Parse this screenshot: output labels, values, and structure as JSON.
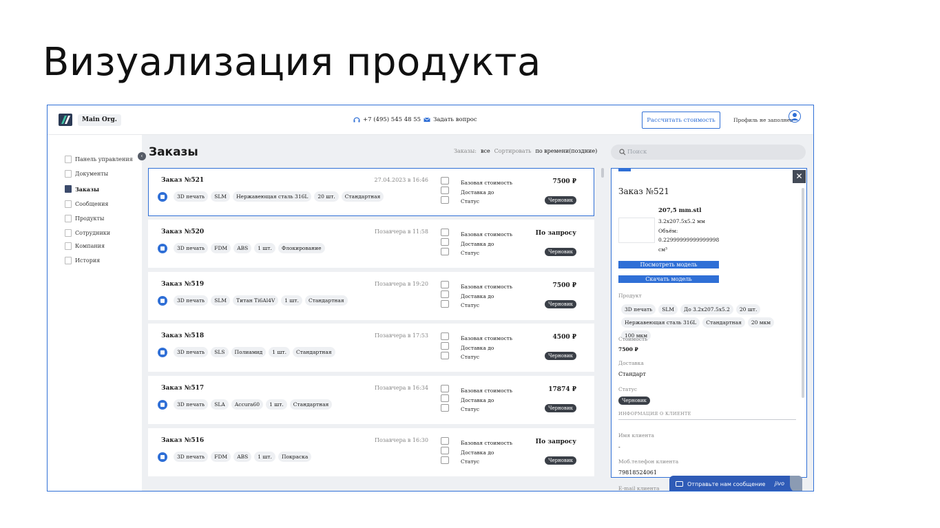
{
  "slide": {
    "title": "Визуализация продукта"
  },
  "header": {
    "org": "Main Org.",
    "phone": "+7 (495) 545 48 55",
    "ask": "Задать вопрос",
    "calc_button": "Рассчитать стоимость",
    "profile": "Профиль не заполнен"
  },
  "sidebar": {
    "items": [
      {
        "label": "Панель управления"
      },
      {
        "label": "Документы"
      },
      {
        "label": "Заказы"
      },
      {
        "label": "Сообщения"
      },
      {
        "label": "Продукты"
      },
      {
        "label": "Сотрудники"
      },
      {
        "label": "Компания"
      },
      {
        "label": "История"
      }
    ]
  },
  "orders": {
    "title": "Заказы",
    "filter_label": "Заказы:",
    "filter_value": "все",
    "sort_label": "Сортировать",
    "sort_value": "по времени(поздние)",
    "search_placeholder": "Поиск",
    "labels": {
      "base": "Базовая стоимость",
      "delivery": "Доставка до",
      "status": "Статус"
    },
    "list": [
      {
        "title": "Заказ №521",
        "date": "27.04.2023 в 16:46",
        "price": "7500 ₽",
        "status": "Черновик",
        "tags": [
          "3D печать",
          "SLM",
          "Нержавеющая сталь 316L",
          "20 шт.",
          "Стандартная"
        ]
      },
      {
        "title": "Заказ №520",
        "date": "Позавчера в 11:58",
        "price": "По запросу",
        "status": "Черновик",
        "tags": [
          "3D печать",
          "FDM",
          "ABS",
          "1 шт.",
          "Флокирование"
        ]
      },
      {
        "title": "Заказ №519",
        "date": "Позавчера в 19:20",
        "price": "7500 ₽",
        "status": "Черновик",
        "tags": [
          "3D печать",
          "SLM",
          "Титан Ti6Al4V",
          "1 шт.",
          "Стандартная"
        ]
      },
      {
        "title": "Заказ №518",
        "date": "Позавчера в 17:53",
        "price": "4500 ₽",
        "status": "Черновик",
        "tags": [
          "3D печать",
          "SLS",
          "Полиамид",
          "1 шт.",
          "Стандартная"
        ]
      },
      {
        "title": "Заказ №517",
        "date": "Позавчера в 16:34",
        "price": "17874 ₽",
        "status": "Черновик",
        "tags": [
          "3D печать",
          "SLA",
          "Accura60",
          "1 шт.",
          "Стандартная"
        ]
      },
      {
        "title": "Заказ №516",
        "date": "Позавчера в 16:30",
        "price": "По запросу",
        "status": "Черновик",
        "tags": [
          "3D печать",
          "FDM",
          "ABS",
          "1 шт.",
          "Покраска"
        ]
      }
    ]
  },
  "detail": {
    "title": "Заказ №521",
    "file_name": "207,5 mm.stl",
    "dims": "3.2x207.5x5.2 мм",
    "volume_label": "Объём:",
    "volume_value": "0.22999999999999998",
    "volume_unit": "см³",
    "view_button": "Посмотреть модель",
    "download_button": "Скачать модель",
    "product_label": "Продукт",
    "product_tags": [
      "3D печать",
      "SLM",
      "До 3.2x207.5x5.2",
      "20 шт.",
      "Нержавеющая сталь 316L",
      "Стандартная",
      "20 мкм",
      "100 мкм"
    ],
    "cost_label": "Стоимость",
    "cost_value": "7500 ₽",
    "delivery_label": "Доставка",
    "delivery_value": "Стандарт",
    "status_label": "Статус",
    "status_value": "Черновик",
    "client_section": "ИНФОРМАЦИЯ О КЛИЕНТЕ",
    "client_name_label": "Имя клиента",
    "client_name_value": "-",
    "client_phone_label": "Моб.телефон клиента",
    "client_phone_value": "79818524061",
    "client_email_label": "E-mail клиента"
  },
  "chat": {
    "label": "Отправьте нам сообщение",
    "brand": "jivo"
  },
  "colors": {
    "accent": "#2f6fd6",
    "pill": "#3a3f47",
    "jivo": "#2f5bb7"
  }
}
